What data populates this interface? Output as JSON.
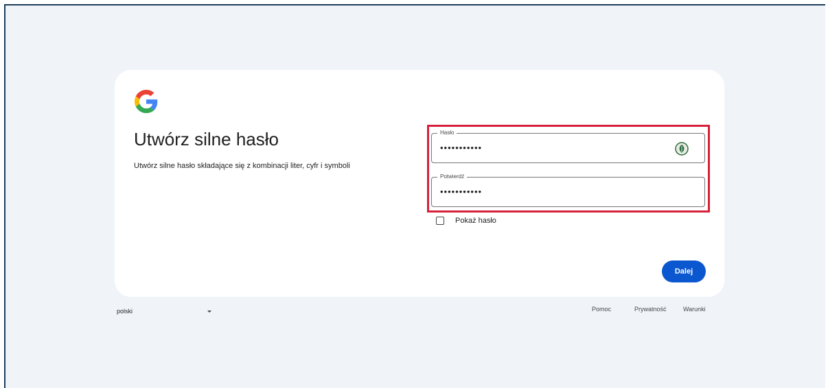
{
  "brand": {
    "logo_icon": "google-g-logo-icon",
    "colors": {
      "blue": "#4285F4",
      "red": "#EA4335",
      "yellow": "#FBBC05",
      "green": "#34A853"
    }
  },
  "page": {
    "title": "Utwórz silne hasło",
    "subtitle": "Utwórz silne hasło składające się z kombinacji liter, cyfr i symboli"
  },
  "form": {
    "password": {
      "label": "Hasło",
      "value": "•••••••••••",
      "extension_icon": "password-manager-extension-icon"
    },
    "confirm": {
      "label": "Potwierdź",
      "value": "•••••••••••"
    },
    "show_password": {
      "label": "Pokaż hasło",
      "checked": false
    },
    "next_label": "Dalej",
    "highlight_color": "#d6203a",
    "primary_color": "#0b57d0"
  },
  "footer": {
    "language": "polski",
    "links": {
      "help": "Pomoc",
      "privacy": "Prywatność",
      "terms": "Warunki"
    }
  }
}
